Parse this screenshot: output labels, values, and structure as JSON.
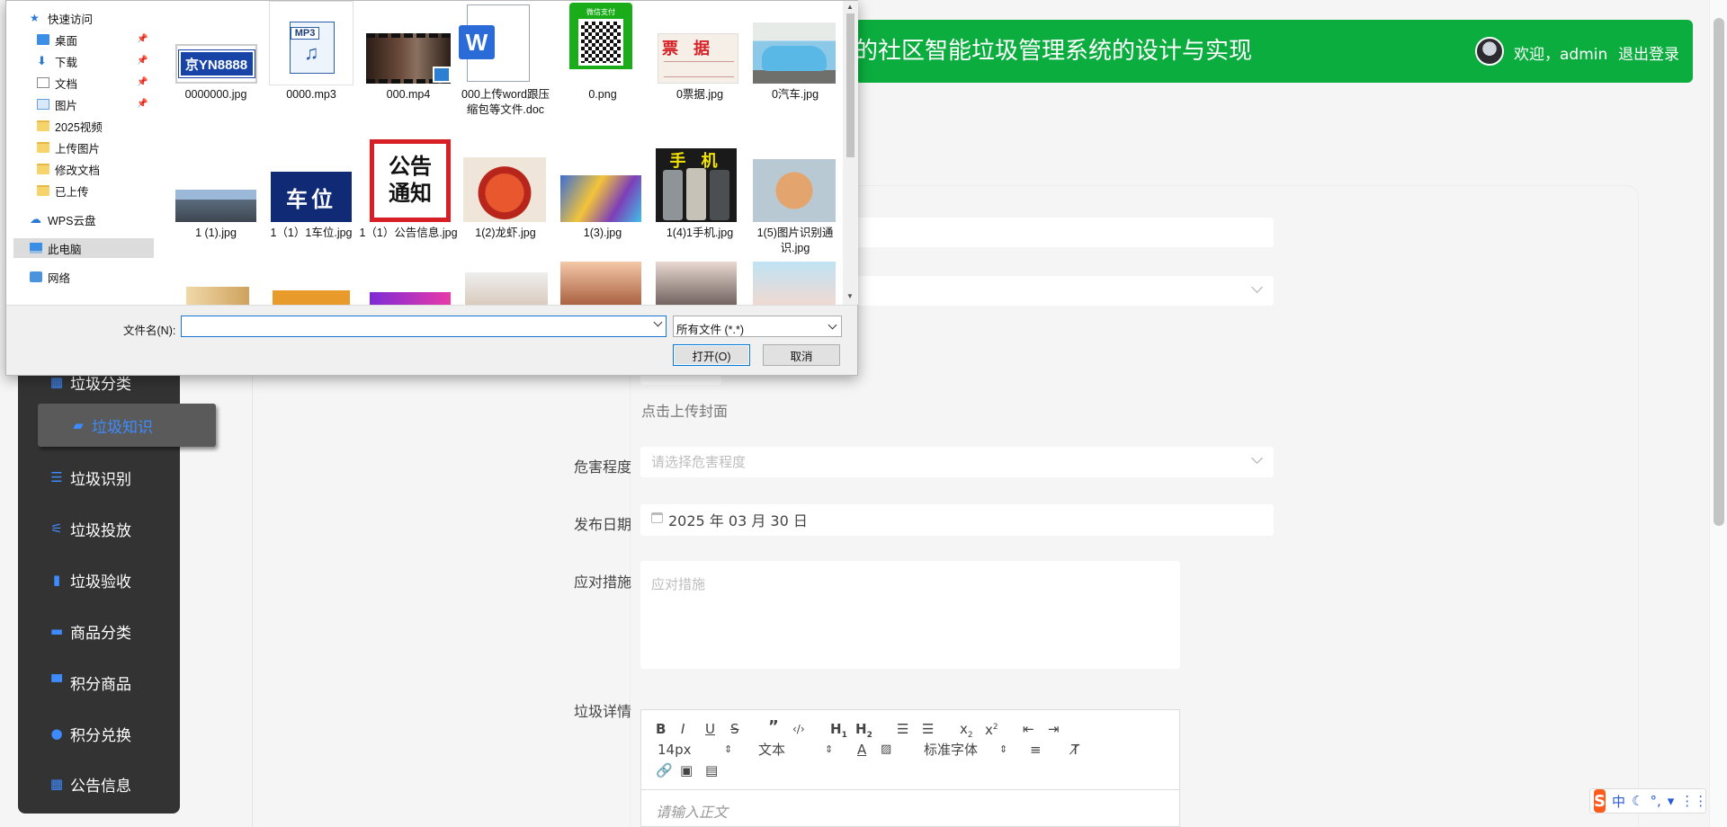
{
  "header": {
    "title": "的社区智能垃圾管理系统的设计与实现",
    "welcome": "欢迎，admin",
    "logout": "退出登录"
  },
  "sidebar": {
    "items": [
      {
        "label": "垃圾分类",
        "icon": "grid-icon"
      },
      {
        "label": "垃圾知识",
        "icon": "book-icon",
        "active": true
      },
      {
        "label": "垃圾识别",
        "icon": "list-icon"
      },
      {
        "label": "垃圾投放",
        "icon": "sliders-icon"
      },
      {
        "label": "垃圾验收",
        "icon": "chart-icon"
      },
      {
        "label": "商品分类",
        "icon": "ticket-icon"
      },
      {
        "label": "积分商品",
        "icon": "chat-icon"
      },
      {
        "label": "积分兑换",
        "icon": "user-icon"
      },
      {
        "label": "公告信息",
        "icon": "grid-icon"
      }
    ]
  },
  "form": {
    "upload_cover": "点击上传封面",
    "hazard_label": "危害程度",
    "hazard_placeholder": "请选择危害程度",
    "date_label": "发布日期",
    "date_value": "2025 年 03 月 30 日",
    "measures_label": "应对措施",
    "measures_placeholder": "应对措施",
    "detail_label": "垃圾详情",
    "editor_placeholder": "请输入正文",
    "toolbar": {
      "font_size": "14px",
      "text_type": "文本",
      "font_family": "标准字体"
    }
  },
  "ime": {
    "lang": "中"
  },
  "dialog": {
    "tree": [
      {
        "label": "快速访问",
        "icon": "star-icon"
      },
      {
        "label": "桌面",
        "icon": "desktop-icon",
        "pinned": true
      },
      {
        "label": "下载",
        "icon": "download-icon",
        "pinned": true
      },
      {
        "label": "文档",
        "icon": "document-icon",
        "pinned": true
      },
      {
        "label": "图片",
        "icon": "picture-icon",
        "pinned": true
      },
      {
        "label": "2025视频",
        "icon": "folder-icon"
      },
      {
        "label": "上传图片",
        "icon": "folder-icon"
      },
      {
        "label": "修改文档",
        "icon": "folder-icon"
      },
      {
        "label": "已上传",
        "icon": "folder-icon"
      },
      {
        "label": "WPS云盘",
        "icon": "cloud-icon"
      },
      {
        "label": "此电脑",
        "icon": "computer-icon",
        "selected": true
      },
      {
        "label": "网络",
        "icon": "network-icon"
      }
    ],
    "files_row1": [
      "0000000.jpg",
      "0000.mp3",
      "000.mp4",
      "000上传word跟压缩包等文件.doc",
      "0.png",
      "0票据.jpg",
      "0汽车.jpg"
    ],
    "files_row2": [
      "1 (1).jpg",
      "1（1）1车位.jpg",
      "1（1）公告信息.jpg",
      "1(2)龙虾.jpg",
      "1(3).jpg",
      "1(4)1手机.jpg",
      "1(5)图片识别通识.jpg"
    ],
    "thumb_text": {
      "plate": "京YN8888",
      "mp3": "MP3",
      "word": "W",
      "pay_header": "微信支付",
      "receipt": "票  据",
      "parking": "车位",
      "notice_1": "公告",
      "notice_2": "通知",
      "phone": "手 机"
    },
    "filename_label": "文件名(N):",
    "filename_value": "",
    "filetype": "所有文件 (*.*)",
    "open_button": "打开(O)",
    "cancel_button": "取消"
  }
}
